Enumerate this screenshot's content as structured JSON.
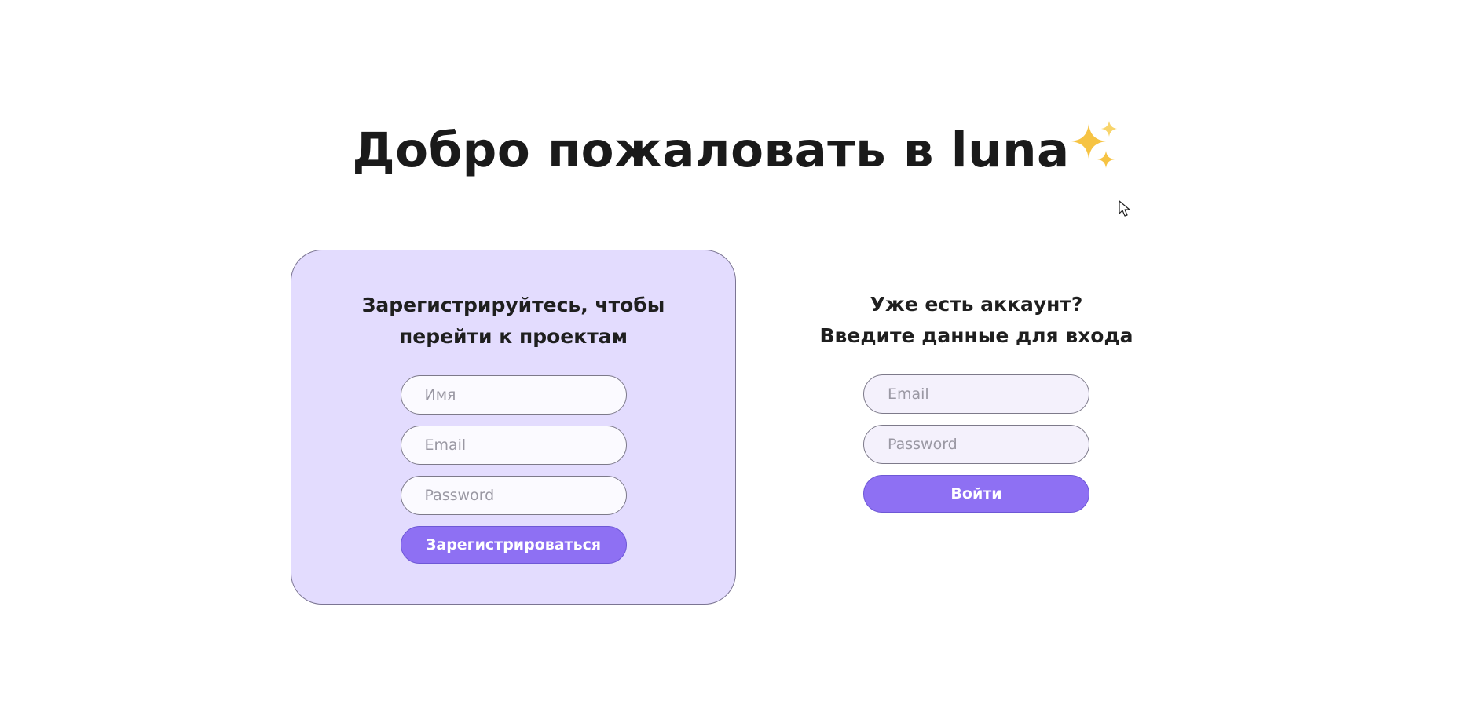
{
  "header": {
    "title": "Добро пожаловать в luna",
    "title_emoji": "sparkles-icon"
  },
  "register": {
    "heading": "Зарегистрируйтесь, чтобы\nперейти к проектам",
    "name_placeholder": "Имя",
    "email_placeholder": "Email",
    "password_placeholder": "Password",
    "submit_label": "Зарегистрироваться"
  },
  "login": {
    "heading": "Уже есть аккаунт?\nВведите данные для входа",
    "email_placeholder": "Email",
    "password_placeholder": "Password",
    "submit_label": "Войти"
  },
  "colors": {
    "accent": "#8e70f3",
    "card_bg": "#e3dcfe",
    "sparkle": "#f6c343"
  }
}
